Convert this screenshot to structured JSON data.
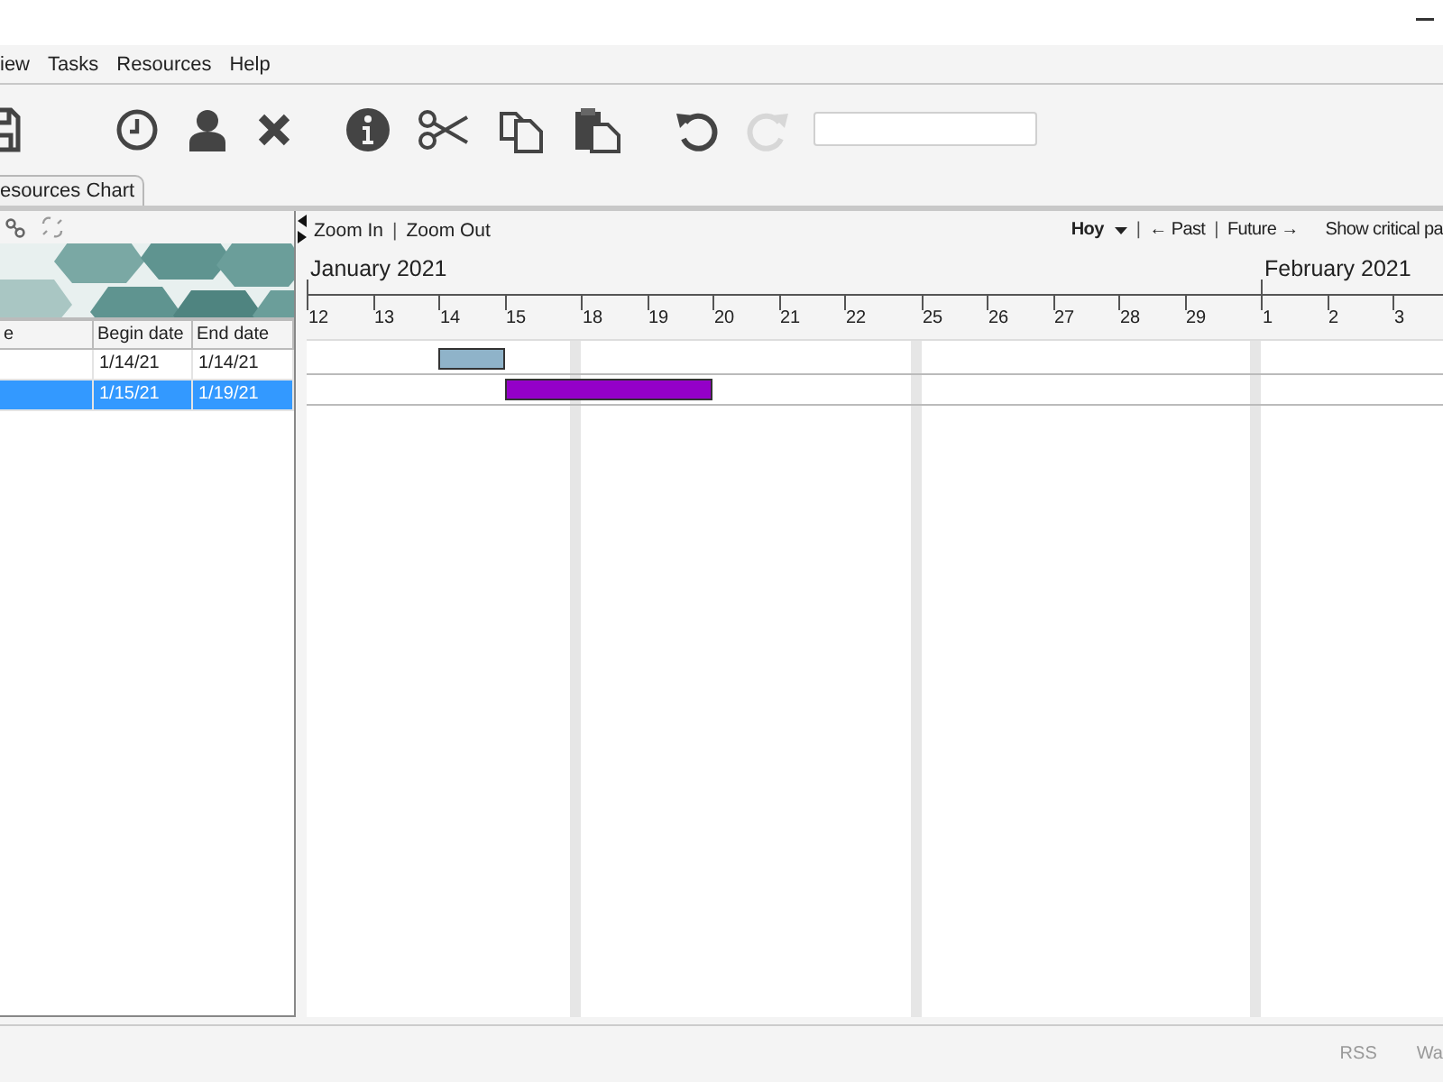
{
  "menu": [
    {
      "label": "iew"
    },
    {
      "label": "Tasks"
    },
    {
      "label": "Resources"
    },
    {
      "label": "Help"
    }
  ],
  "toolbar": [
    {
      "kind": "save",
      "disabled": false
    },
    {
      "kind": "gap"
    },
    {
      "kind": "clock",
      "disabled": false
    },
    {
      "kind": "person",
      "disabled": false
    },
    {
      "kind": "delete",
      "disabled": false
    },
    {
      "kind": "gap"
    },
    {
      "kind": "info",
      "disabled": false
    },
    {
      "kind": "cut",
      "disabled": false
    },
    {
      "kind": "copy",
      "disabled": false
    },
    {
      "kind": "paste",
      "disabled": false
    },
    {
      "kind": "gap"
    },
    {
      "kind": "undo",
      "disabled": false
    },
    {
      "kind": "redo",
      "disabled": true
    },
    {
      "kind": "search"
    }
  ],
  "tabs": [
    {
      "label": "esources Chart",
      "selected": false
    }
  ],
  "table": {
    "columns": [
      "e",
      "Begin date",
      "End date"
    ],
    "rows": [
      {
        "begin": "1/14/21",
        "end": "1/14/21",
        "selected": false,
        "color": "#8fb3c9"
      },
      {
        "begin": "1/15/21",
        "end": "1/19/21",
        "selected": true,
        "color": "#9400c8"
      }
    ]
  },
  "chart_toolbar": {
    "left": [
      {
        "kind": "link",
        "label": "Zoom In"
      },
      {
        "kind": "sep",
        "label": "|"
      },
      {
        "kind": "link",
        "label": "Zoom Out"
      }
    ],
    "right": [
      {
        "kind": "menu",
        "label": "Hoy"
      },
      {
        "kind": "sep",
        "label": "|"
      },
      {
        "kind": "link",
        "label": "← Past"
      },
      {
        "kind": "sep",
        "label": "|"
      },
      {
        "kind": "link",
        "label": "Future →"
      },
      {
        "kind": "link",
        "label": "Show critical pa"
      }
    ]
  },
  "timeline": [
    {
      "kind": "day",
      "label": "12",
      "month": "January 2021"
    },
    {
      "kind": "day",
      "label": "13"
    },
    {
      "kind": "day",
      "label": "14"
    },
    {
      "kind": "day",
      "label": "15"
    },
    {
      "kind": "weekend"
    },
    {
      "kind": "day",
      "label": "18"
    },
    {
      "kind": "day",
      "label": "19"
    },
    {
      "kind": "day",
      "label": "20"
    },
    {
      "kind": "day",
      "label": "21"
    },
    {
      "kind": "day",
      "label": "22"
    },
    {
      "kind": "weekend"
    },
    {
      "kind": "day",
      "label": "25"
    },
    {
      "kind": "day",
      "label": "26"
    },
    {
      "kind": "day",
      "label": "27"
    },
    {
      "kind": "day",
      "label": "28"
    },
    {
      "kind": "day",
      "label": "29"
    },
    {
      "kind": "weekend"
    },
    {
      "kind": "day",
      "label": "1",
      "month": "February 2021"
    },
    {
      "kind": "day",
      "label": "2"
    },
    {
      "kind": "day",
      "label": "3"
    }
  ],
  "status_bar": [
    {
      "label": "RSS"
    },
    {
      "label": "Wa"
    }
  ]
}
